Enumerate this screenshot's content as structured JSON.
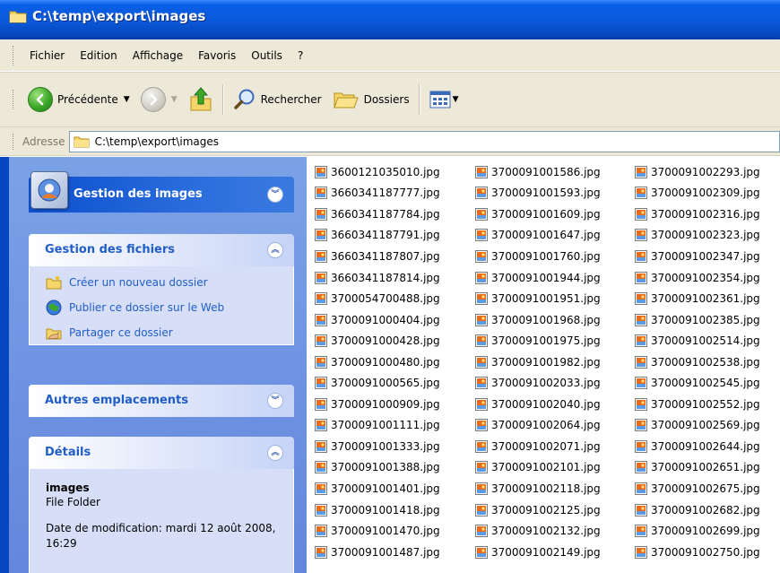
{
  "window": {
    "title": "C:\\temp\\export\\images"
  },
  "menubar": {
    "items": [
      "Fichier",
      "Edition",
      "Affichage",
      "Favoris",
      "Outils",
      "?"
    ]
  },
  "toolbar": {
    "back_label": "Précédente",
    "search_label": "Rechercher",
    "folders_label": "Dossiers"
  },
  "address": {
    "label": "Adresse",
    "path": "C:\\temp\\export\\images"
  },
  "taskpane": {
    "special": {
      "title": "Gestion des images"
    },
    "file_tasks": {
      "title": "Gestion des fichiers",
      "items": [
        "Créer un nouveau dossier",
        "Publier ce dossier sur le Web",
        "Partager ce dossier"
      ]
    },
    "other_places": {
      "title": "Autres emplacements"
    },
    "details": {
      "title": "Détails",
      "name": "images",
      "type": "File Folder",
      "date": "Date de modification: mardi 12 août 2008, 16:29"
    }
  },
  "files": {
    "col1": [
      "3600121035010.jpg",
      "3660341187777.jpg",
      "3660341187784.jpg",
      "3660341187791.jpg",
      "3660341187807.jpg",
      "3660341187814.jpg",
      "3700054700488.jpg",
      "3700091000404.jpg",
      "3700091000428.jpg",
      "3700091000480.jpg",
      "3700091000565.jpg",
      "3700091000909.jpg",
      "3700091001111.jpg",
      "3700091001333.jpg",
      "3700091001388.jpg",
      "3700091001401.jpg",
      "3700091001418.jpg",
      "3700091001470.jpg",
      "3700091001487.jpg"
    ],
    "col2": [
      "3700091001586.jpg",
      "3700091001593.jpg",
      "3700091001609.jpg",
      "3700091001647.jpg",
      "3700091001760.jpg",
      "3700091001944.jpg",
      "3700091001951.jpg",
      "3700091001968.jpg",
      "3700091001975.jpg",
      "3700091001982.jpg",
      "3700091002033.jpg",
      "3700091002040.jpg",
      "3700091002064.jpg",
      "3700091002071.jpg",
      "3700091002101.jpg",
      "3700091002118.jpg",
      "3700091002125.jpg",
      "3700091002132.jpg",
      "3700091002149.jpg"
    ],
    "col3": [
      "3700091002293.jpg",
      "3700091002309.jpg",
      "3700091002316.jpg",
      "3700091002323.jpg",
      "3700091002347.jpg",
      "3700091002354.jpg",
      "3700091002361.jpg",
      "3700091002385.jpg",
      "3700091002514.jpg",
      "3700091002538.jpg",
      "3700091002545.jpg",
      "3700091002552.jpg",
      "3700091002569.jpg",
      "3700091002644.jpg",
      "3700091002651.jpg",
      "3700091002675.jpg",
      "3700091002682.jpg",
      "3700091002699.jpg",
      "3700091002750.jpg"
    ]
  }
}
